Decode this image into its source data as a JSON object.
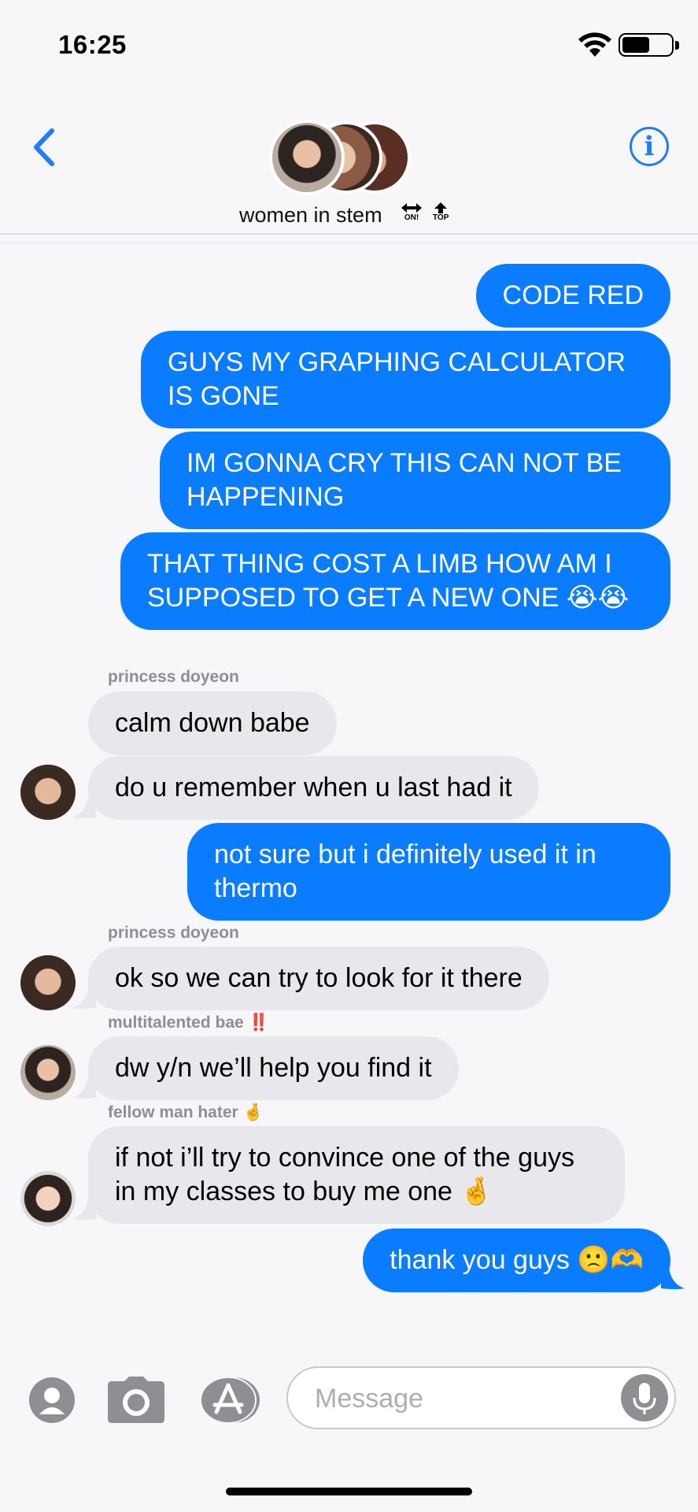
{
  "status_bar": {
    "time": "16:25"
  },
  "header": {
    "group_name": "women in stem",
    "icon1_label": "ON!",
    "icon2_label": "TOP"
  },
  "messages": [
    {
      "dir": "out",
      "text": "CODE RED"
    },
    {
      "dir": "out",
      "text": "GUYS MY GRAPHING CALCULATOR IS GONE"
    },
    {
      "dir": "out",
      "text": "IM GONNA CRY THIS CAN NOT BE HAPPENING"
    },
    {
      "dir": "out",
      "text": "THAT THING COST A LIMB HOW AM I SUPPOSED TO GET A NEW ONE 😭😭"
    },
    {
      "dir": "in",
      "sender": "princess doyeon",
      "text": "calm down babe"
    },
    {
      "dir": "in",
      "text": "do u remember when u last had it"
    },
    {
      "dir": "out",
      "text": "not sure but i definitely used it in thermo"
    },
    {
      "dir": "in",
      "sender": "princess doyeon",
      "text": "ok so we can try to look for it there"
    },
    {
      "dir": "in",
      "sender": "multitalented bae ‼️",
      "text": "dw y/n we’ll help you find it"
    },
    {
      "dir": "in",
      "sender": "fellow man hater 🤞",
      "text": "if not i’ll try to convince one of the guys in my classes to buy me one 🤞"
    },
    {
      "dir": "out",
      "text": "thank you guys 🙁🫶"
    }
  ],
  "input": {
    "placeholder": "Message"
  },
  "colors": {
    "accent": "#0a7cff",
    "incoming": "#e8e7ec",
    "sender_label": "#8e8e93"
  }
}
